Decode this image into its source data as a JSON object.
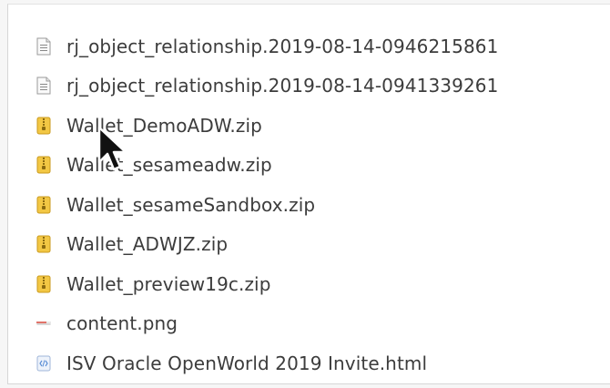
{
  "file_manager": {
    "files": [
      {
        "name": "rj_object_relationship.2019-08-14-0946215861",
        "icon": "text-file-icon"
      },
      {
        "name": "rj_object_relationship.2019-08-14-0941339261",
        "icon": "text-file-icon"
      },
      {
        "name": "Wallet_DemoADW.zip",
        "icon": "zip-archive-icon"
      },
      {
        "name": "Wallet_sesameadw.zip",
        "icon": "zip-archive-icon"
      },
      {
        "name": "Wallet_sesameSandbox.zip",
        "icon": "zip-archive-icon"
      },
      {
        "name": "Wallet_ADWJZ.zip",
        "icon": "zip-archive-icon"
      },
      {
        "name": "Wallet_preview19c.zip",
        "icon": "zip-archive-icon"
      },
      {
        "name": "content.png",
        "icon": "image-file-icon"
      },
      {
        "name": "ISV Oracle OpenWorld 2019 Invite.html",
        "icon": "html-file-icon"
      }
    ]
  },
  "colors": {
    "text": "#3c3c3c",
    "zip_icon": "#f2c744",
    "image_icon": "#e0736a",
    "html_icon": "#5b8fd6"
  }
}
